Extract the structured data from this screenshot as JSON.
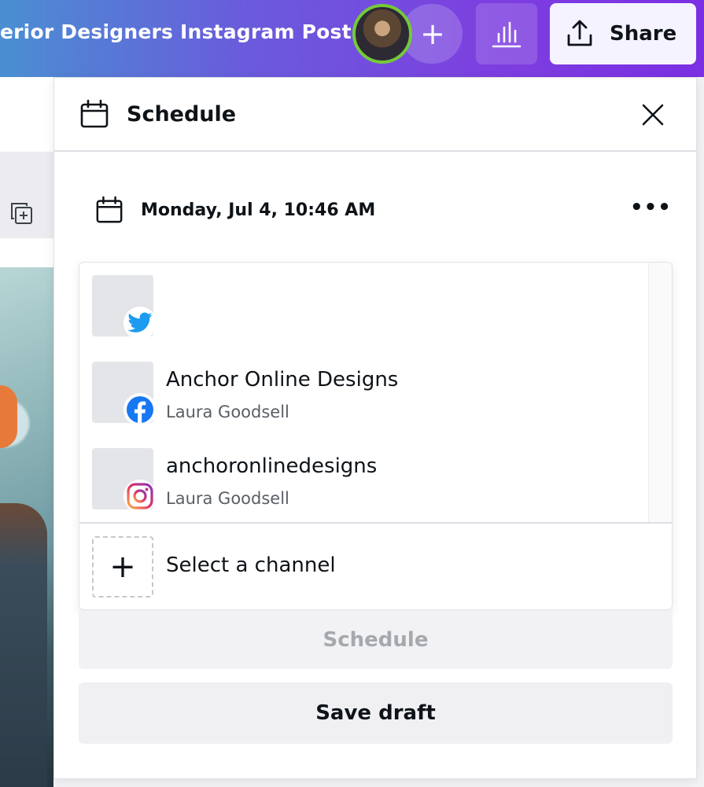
{
  "topbar": {
    "doc_title": "erior Designers Instagram Post",
    "add_label": "+",
    "share_label": "Share"
  },
  "panel": {
    "title": "Schedule",
    "date": "Monday, Jul 4, 10:46 AM",
    "more_label": "•••",
    "channels": [
      {
        "network": "twitter",
        "name": "",
        "sub": ""
      },
      {
        "network": "facebook",
        "name": "Anchor Online Designs",
        "sub": "Laura Goodsell"
      },
      {
        "network": "instagram",
        "name": "anchoronlinedesigns",
        "sub": "Laura Goodsell"
      }
    ],
    "select_label": "Select a channel",
    "add_channel_label": "+",
    "schedule_label": "Schedule",
    "save_draft_label": "Save draft"
  },
  "colors": {
    "twitter": "#1d9bf0",
    "facebook": "#1877f2",
    "avatar_ring": "#74c93a",
    "disabled_text": "#a5a8ad"
  },
  "icons": [
    "calendar-icon",
    "close-icon",
    "more-icon",
    "share-icon",
    "insights-icon",
    "twitter-icon",
    "facebook-icon",
    "instagram-icon",
    "plus-icon",
    "duplicate-page-icon"
  ]
}
